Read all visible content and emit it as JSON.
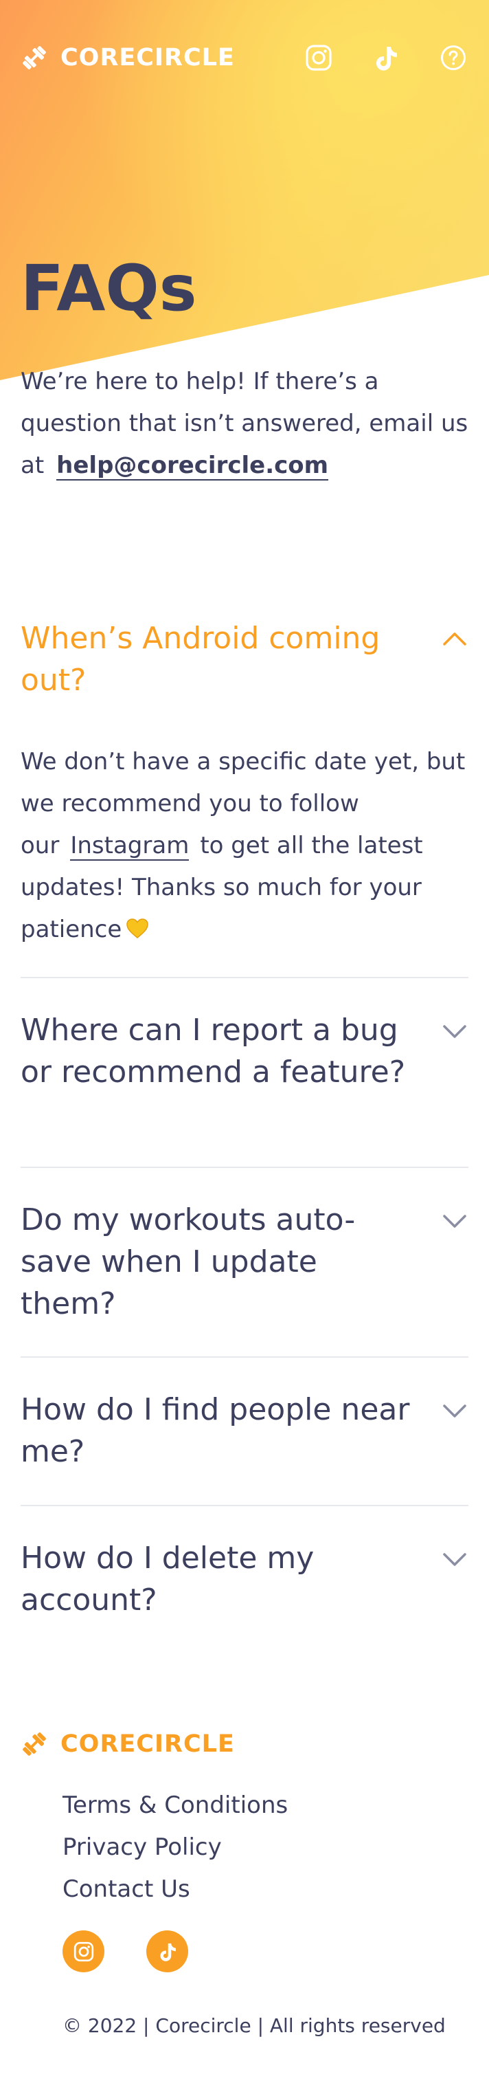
{
  "brand": {
    "name": "CORECIRCLE"
  },
  "header": {
    "icons": [
      "instagram-icon",
      "tiktok-icon",
      "help-icon"
    ]
  },
  "page": {
    "title": "FAQs",
    "intro_text": "We’re here to help! If there’s a question that isn’t answered, email us at",
    "email": "help@corecircle.com"
  },
  "faqs": [
    {
      "question": "When’s Android coming out?",
      "expanded": true,
      "answer_before": "We don’t have a specific date yet, but we recommend you to follow our",
      "answer_link": "Instagram",
      "answer_after": "to get all the latest updates! Thanks so much for your patience",
      "answer_emoji": "yellow-heart-icon"
    },
    {
      "question": "Where can I report a bug or recommend a feature?",
      "expanded": false
    },
    {
      "question": "Do my workouts auto-save when I update them?",
      "expanded": false
    },
    {
      "question": "How do I find people near me?",
      "expanded": false
    },
    {
      "question": "How do I delete my account?",
      "expanded": false
    }
  ],
  "footer": {
    "brand": "CORECIRCLE",
    "links": [
      "Terms & Conditions",
      "Privacy Policy",
      "Contact Us"
    ],
    "social": [
      "instagram-icon",
      "tiktok-icon"
    ],
    "copyright": "© 2022 | Corecircle | All rights reserved"
  },
  "colors": {
    "accent": "#f9a024",
    "text": "#3d3f5e",
    "divider": "#e7e7ee",
    "hero_gradient": [
      "#fd9d55",
      "#fdd45e",
      "#fde163"
    ]
  }
}
